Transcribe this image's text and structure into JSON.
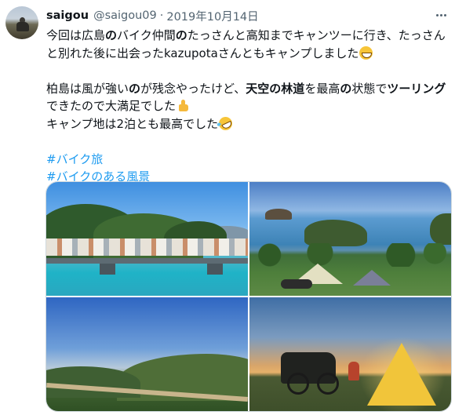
{
  "tweet": {
    "display_name": "saigou",
    "handle": "@saigou09",
    "separator": "·",
    "date": "2019年10月14日",
    "more_label": "More",
    "text": {
      "line1_a": "今回は広島",
      "line1_b": "の",
      "line1_c": "バイク仲間",
      "line1_d": "の",
      "line1_e": "たっさんと高知までキャンツーに行き、たっさん",
      "line2": "と別れた後に出会ったkazupotaさんともキャンプしました",
      "line3_a": "柏島は風が強い",
      "line3_b": "の",
      "line3_c": "が残念やったけど、",
      "line3_d": "天空の林道",
      "line3_e": "を最高",
      "line3_f": "の",
      "line3_g": "状態で",
      "line3_h": "ツーリング",
      "line4": "できたので大満足でした",
      "line5": "キャンプ地は2泊とも最高でした"
    },
    "hashtags": [
      "#バイク旅",
      "#バイクのある風景"
    ]
  },
  "icons": {
    "emoji_1": "grinning-face-emoji",
    "emoji_2": "thumbs-up-emoji",
    "emoji_3": "rolling-on-floor-laughing-emoji",
    "more": "more-dots-icon"
  },
  "colors": {
    "text_primary": "#0f1419",
    "text_secondary": "#536471",
    "hashtag": "#1d9bf0",
    "border": "#cfd9de"
  },
  "media": {
    "count": 4
  }
}
